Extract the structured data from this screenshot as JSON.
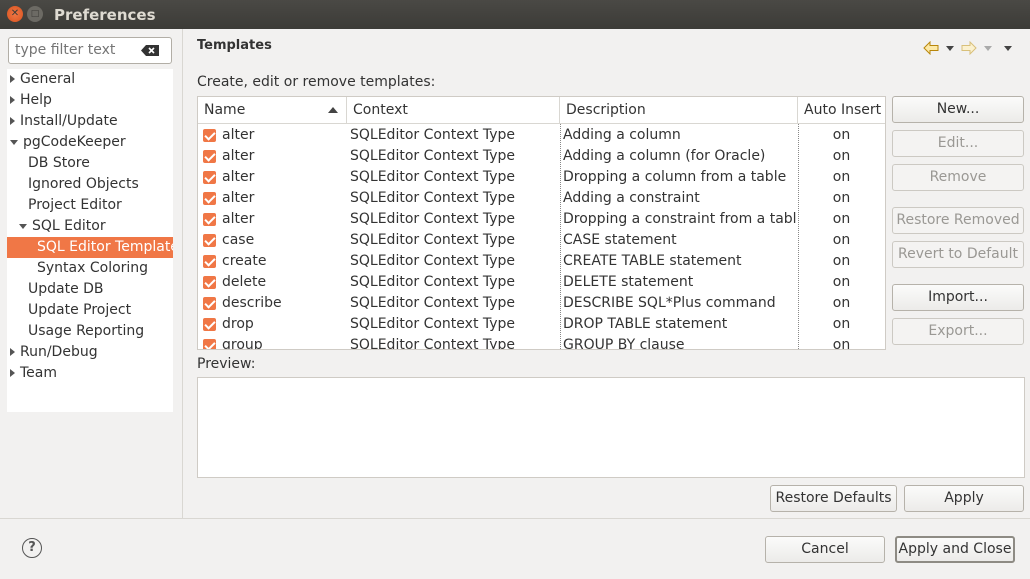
{
  "window": {
    "title": "Preferences"
  },
  "filter": {
    "placeholder": "type filter text"
  },
  "tree": {
    "items": [
      {
        "label": "General",
        "expanded": false
      },
      {
        "label": "Help",
        "expanded": false
      },
      {
        "label": "Install/Update",
        "expanded": false
      },
      {
        "label": "pgCodeKeeper",
        "expanded": true
      },
      {
        "label": "DB Store"
      },
      {
        "label": "Ignored Objects"
      },
      {
        "label": "Project Editor"
      },
      {
        "label": "SQL Editor",
        "expanded": true
      },
      {
        "label": "SQL Editor Templates",
        "selected": true
      },
      {
        "label": "Syntax Coloring"
      },
      {
        "label": "Update DB"
      },
      {
        "label": "Update Project"
      },
      {
        "label": "Usage Reporting"
      },
      {
        "label": "Run/Debug",
        "expanded": false
      },
      {
        "label": "Team",
        "expanded": false
      }
    ]
  },
  "page": {
    "title": "Templates",
    "subtitle": "Create, edit or remove templates:",
    "preview_label": "Preview:"
  },
  "table": {
    "columns": [
      "Name",
      "Context",
      "Description",
      "Auto Insert"
    ],
    "rows": [
      {
        "name": "alter",
        "context": "SQLEditor Context Type",
        "description": "Adding a column",
        "auto_insert": "on"
      },
      {
        "name": "alter",
        "context": "SQLEditor Context Type",
        "description": "Adding a column (for Oracle)",
        "auto_insert": "on"
      },
      {
        "name": "alter",
        "context": "SQLEditor Context Type",
        "description": "Dropping a column from a table",
        "auto_insert": "on"
      },
      {
        "name": "alter",
        "context": "SQLEditor Context Type",
        "description": "Adding a constraint",
        "auto_insert": "on"
      },
      {
        "name": "alter",
        "context": "SQLEditor Context Type",
        "description": "Dropping a constraint from a table",
        "auto_insert": "on"
      },
      {
        "name": "case",
        "context": "SQLEditor Context Type",
        "description": "CASE statement",
        "auto_insert": "on"
      },
      {
        "name": "create",
        "context": "SQLEditor Context Type",
        "description": "CREATE TABLE statement",
        "auto_insert": "on"
      },
      {
        "name": "delete",
        "context": "SQLEditor Context Type",
        "description": "DELETE statement",
        "auto_insert": "on"
      },
      {
        "name": "describe",
        "context": "SQLEditor Context Type",
        "description": "DESCRIBE SQL*Plus command",
        "auto_insert": "on"
      },
      {
        "name": "drop",
        "context": "SQLEditor Context Type",
        "description": "DROP TABLE statement",
        "auto_insert": "on"
      },
      {
        "name": "group",
        "context": "SQLEditor Context Type",
        "description": "GROUP BY clause",
        "auto_insert": "on"
      }
    ]
  },
  "buttons": {
    "new": "New...",
    "edit": "Edit...",
    "remove": "Remove",
    "restore_removed": "Restore Removed",
    "revert_to_default": "Revert to Default",
    "import": "Import...",
    "export": "Export...",
    "restore_defaults": "Restore Defaults",
    "apply": "Apply",
    "cancel": "Cancel",
    "apply_and_close": "Apply and Close"
  },
  "colors": {
    "accent": "#f07746",
    "titlebar": "#3c3b37"
  }
}
